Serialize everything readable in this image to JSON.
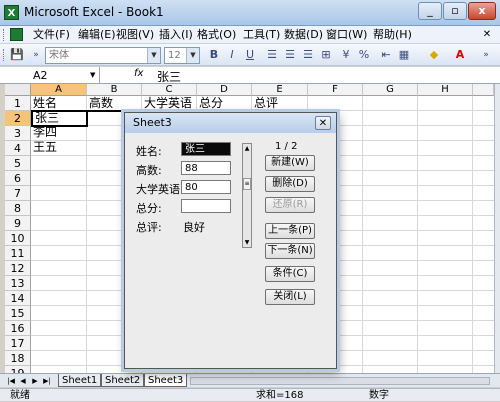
{
  "window": {
    "title": "Microsoft Excel - Book1",
    "app_icon": "excel-icon",
    "controls": {
      "minimize": "_",
      "restore": "▫",
      "close": "x"
    }
  },
  "menu": {
    "items": [
      "文件(F)",
      "编辑(E)",
      "视图(V)",
      "插入(I)",
      "格式(O)",
      "工具(T)",
      "数据(D)",
      "窗口(W)",
      "帮助(H)"
    ]
  },
  "toolbar": {
    "font": "宋体",
    "size": "12",
    "bold": "B",
    "italic": "I",
    "underline": "U",
    "percent": "%"
  },
  "formula": {
    "name_box": "A2",
    "fx": "fx",
    "content": "张三"
  },
  "grid": {
    "columns": [
      "A",
      "B",
      "C",
      "D",
      "E",
      "F",
      "G",
      "H"
    ],
    "rows": [
      "1",
      "2",
      "3",
      "4",
      "5",
      "6",
      "7",
      "8",
      "9",
      "10",
      "11",
      "12",
      "13",
      "14",
      "15",
      "16",
      "17",
      "18",
      "19"
    ],
    "row1": [
      "姓名",
      "高数",
      "大学英语",
      "总分",
      "总评"
    ],
    "a2": "张三",
    "a3": "李四",
    "a4": "王五"
  },
  "dialog": {
    "title": "Sheet3",
    "record": "1 / 2",
    "fields": [
      {
        "label": "姓名:",
        "value": "张三"
      },
      {
        "label": "高数:",
        "value": "88"
      },
      {
        "label": "大学英语:",
        "value": "80"
      },
      {
        "label": "总分:",
        "value": ""
      },
      {
        "label": "总评:",
        "value": "良好"
      }
    ],
    "buttons": {
      "new": "新建(W)",
      "delete": "删除(D)",
      "restore": "还原(R)",
      "prev": "上一条(P)",
      "next": "下一条(N)",
      "criteria": "条件(C)",
      "close": "关闭(L)"
    }
  },
  "sheets": {
    "tabs": [
      "Sheet1",
      "Sheet2",
      "Sheet3"
    ],
    "active": "Sheet3"
  },
  "status": {
    "ready": "就绪",
    "sum": "求和=168",
    "mode": "数字"
  }
}
